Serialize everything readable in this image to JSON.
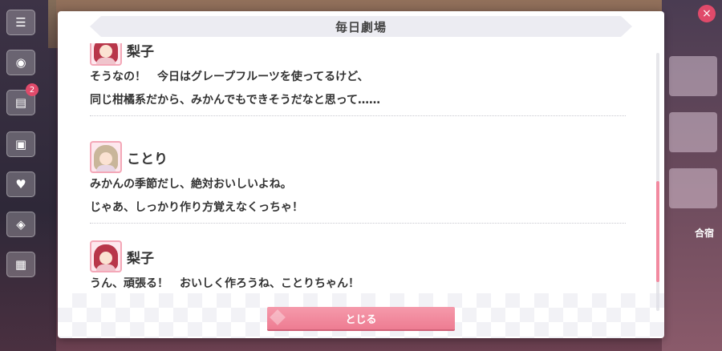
{
  "modal": {
    "title": "毎日劇場",
    "close_label": "とじる"
  },
  "background": {
    "side_badge": "2",
    "right_tag": "合宿"
  },
  "entries": [
    {
      "speaker": "梨子",
      "avatar": "riko-avatar",
      "lines": [
        "そうなの！　今日はグレープフルーツを使ってるけど、",
        "同じ柑橘系だから、みかんでもできそうだなと思って……"
      ]
    },
    {
      "speaker": "ことり",
      "avatar": "kotori-avatar",
      "lines": [
        "みかんの季節だし、絶対おいしいよね。",
        "じゃあ、しっかり作り方覚えなくっちゃ！"
      ]
    },
    {
      "speaker": "梨子",
      "avatar": "riko-avatar",
      "lines": [
        "うん、頑張る！　おいしく作ろうね、ことりちゃん！"
      ]
    }
  ],
  "colors": {
    "accent": "#ee7c92",
    "riko_hair": "#b8364a",
    "kotori_hair": "#c9b69a",
    "scrollbar": "#f28aa0"
  }
}
